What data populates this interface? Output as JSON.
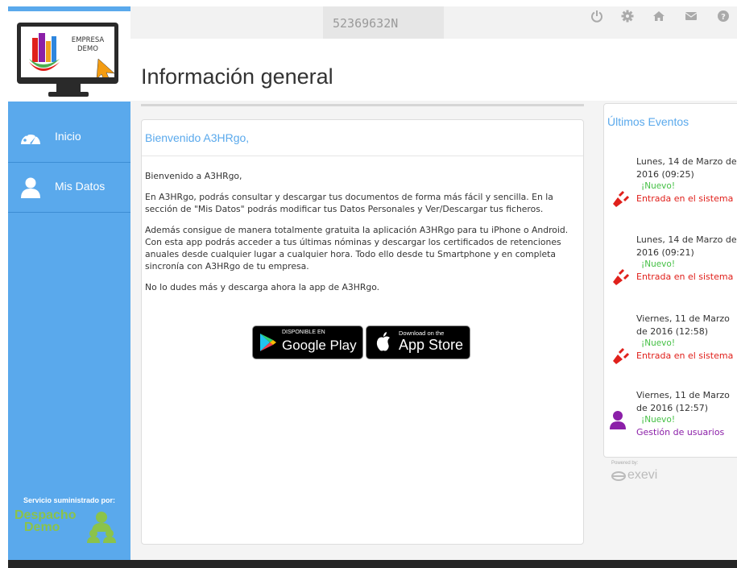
{
  "brand": {
    "logo_line1": "EMPRESA",
    "logo_line2": "DEMO"
  },
  "sidebar": {
    "items": [
      {
        "label": "Inicio",
        "icon": "dashboard-icon"
      },
      {
        "label": "Mis Datos",
        "icon": "user-icon"
      }
    ],
    "service_label": "Servicio suministrado por:",
    "provider_line1": "Despacho",
    "provider_line2": "Demo"
  },
  "header": {
    "user_id": "52369632N",
    "icons": [
      "power-icon",
      "gear-icon",
      "home-icon",
      "mail-icon",
      "help-icon"
    ]
  },
  "page": {
    "title": "Información general"
  },
  "welcome": {
    "heading": "Bienvenido A3HRgo,",
    "paragraphs": [
      "Bienvenido a A3HRgo,",
      "En A3HRgo, podrás consultar y descargar tus documentos de forma más fácil y sencilla. En la sección de \"Mis Datos\" podrás modificar tus Datos Personales y Ver/Descargar tus ficheros.",
      "Además consigue de manera totalmente gratuita la aplicación A3HRgo para tu iPhone o Android. Con esta app podrás acceder a tus últimas nóminas y descargar los certificados de retenciones anuales desde cualquier lugar a cualquier hora. Todo ello desde tu Smartphone y en completa sincronía con A3HRgo de tu empresa.",
      "No lo dudes más y descarga ahora la app de A3HRgo."
    ],
    "google_play": {
      "small": "DISPONIBLE EN",
      "big": "Google Play"
    },
    "app_store": {
      "small": "Download on the",
      "big": "App Store"
    }
  },
  "events": {
    "heading": "Últimos Eventos",
    "items": [
      {
        "date": "Lunes, 14 de Marzo de 2016 (09:25)",
        "badge": "¡Nuevo!",
        "desc": "Entrada en el sistema",
        "color": "#e0201b",
        "icon": "plug-icon"
      },
      {
        "date": "Lunes, 14 de Marzo de 2016 (09:21)",
        "badge": "¡Nuevo!",
        "desc": "Entrada en el sistema",
        "color": "#e0201b",
        "icon": "plug-icon"
      },
      {
        "date": "Viernes, 11 de Marzo de 2016 (12:58)",
        "badge": "¡Nuevo!",
        "desc": "Entrada en el sistema",
        "color": "#e0201b",
        "icon": "plug-icon"
      },
      {
        "date": "Viernes, 11 de Marzo de 2016 (12:57)",
        "badge": "¡Nuevo!",
        "desc": "Gestión de usuarios",
        "color": "#8b1fa8",
        "icon": "user-icon"
      }
    ]
  },
  "footer": {
    "powered_by": "Powered by:",
    "powered_brand": "exevi"
  },
  "colors": {
    "accent": "#5aa9ec",
    "new_badge": "#44c044",
    "event_red": "#e0201b",
    "event_purple": "#8b1fa8"
  }
}
